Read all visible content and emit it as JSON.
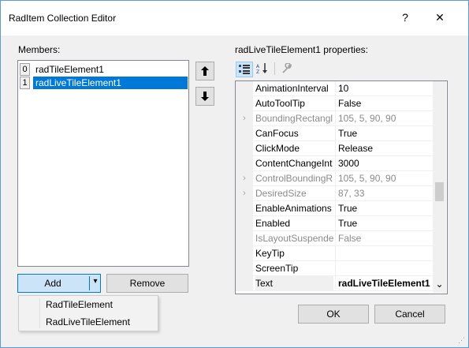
{
  "window": {
    "title": "RadItem Collection Editor",
    "help_glyph": "?",
    "close_glyph": "✕"
  },
  "members": {
    "label": "Members:",
    "items": [
      {
        "index": "0",
        "name": "radTileElement1"
      },
      {
        "index": "1",
        "name": "radLiveTileElement1"
      }
    ],
    "selected_index": 1,
    "move_up_glyph": "🡅",
    "move_down_glyph": "🡇"
  },
  "properties": {
    "label": "radLiveTileElement1 properties:",
    "toolbar": {
      "categorized_icon": "categorized-icon",
      "alphabetical_icon": "alphabetical-icon",
      "property_pages_icon": "property-pages-icon"
    },
    "rows": [
      {
        "name": "AnimationInterval",
        "value": "10",
        "expandable": false,
        "dim": false
      },
      {
        "name": "AutoToolTip",
        "value": "False",
        "expandable": false,
        "dim": false
      },
      {
        "name": "BoundingRectangl",
        "value": "105, 5, 90, 90",
        "expandable": true,
        "dim": true
      },
      {
        "name": "CanFocus",
        "value": "True",
        "expandable": false,
        "dim": false
      },
      {
        "name": "ClickMode",
        "value": "Release",
        "expandable": false,
        "dim": false
      },
      {
        "name": "ContentChangeInt",
        "value": "3000",
        "expandable": false,
        "dim": false
      },
      {
        "name": "ControlBoundingR",
        "value": "105, 5, 90, 90",
        "expandable": true,
        "dim": true
      },
      {
        "name": "DesiredSize",
        "value": "87, 33",
        "expandable": true,
        "dim": true
      },
      {
        "name": "EnableAnimations",
        "value": "True",
        "expandable": false,
        "dim": false
      },
      {
        "name": "Enabled",
        "value": "True",
        "expandable": false,
        "dim": false
      },
      {
        "name": "IsLayoutSuspendec",
        "value": "False",
        "expandable": false,
        "dim": true
      },
      {
        "name": "KeyTip",
        "value": "",
        "expandable": false,
        "dim": false
      },
      {
        "name": "ScreenTip",
        "value": "",
        "expandable": false,
        "dim": false
      },
      {
        "name": "Text",
        "value": "radLiveTileElement1",
        "expandable": false,
        "dim": false
      }
    ],
    "expand_glyph": "›",
    "scroll_down_glyph": "⌄",
    "scroll_position": 0.55
  },
  "buttons": {
    "add": "Add",
    "add_dropdown_glyph": "▾",
    "remove": "Remove",
    "ok": "OK",
    "cancel": "Cancel"
  },
  "add_menu": {
    "items": [
      "RadTileElement",
      "RadLiveTileElement"
    ]
  },
  "colors": {
    "selection": "#0078d7",
    "window_border": "#5b9bd5",
    "face": "#f0f0f0"
  }
}
